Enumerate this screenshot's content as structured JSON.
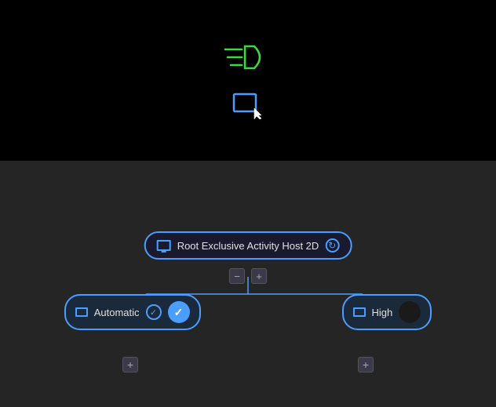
{
  "preview": {
    "background": "#000000"
  },
  "icons": {
    "headlight": "headlight-icon",
    "monitor": "monitor-icon",
    "cursor": "cursor-icon"
  },
  "root_node": {
    "label": "Root Exclusive Activity Host 2D",
    "monitor_icon": "monitor-icon",
    "refresh_icon": "refresh-icon"
  },
  "connector_buttons": {
    "minus": "−",
    "plus": "+"
  },
  "auto_node": {
    "label": "Automatic",
    "monitor_icon": "monitor-icon",
    "check_outline": "check-outline-icon",
    "check_filled": "check-filled-icon"
  },
  "high_node": {
    "label": "High",
    "monitor_icon": "monitor-icon",
    "circle_icon": "circle-dark-icon"
  },
  "plus_buttons": {
    "left": "+",
    "right": "+"
  },
  "colors": {
    "accent_blue": "#4a9eff",
    "green": "#3ddc3d",
    "bg_dark": "#000000",
    "bg_medium": "#252525",
    "bg_node": "#1a2a3a"
  }
}
